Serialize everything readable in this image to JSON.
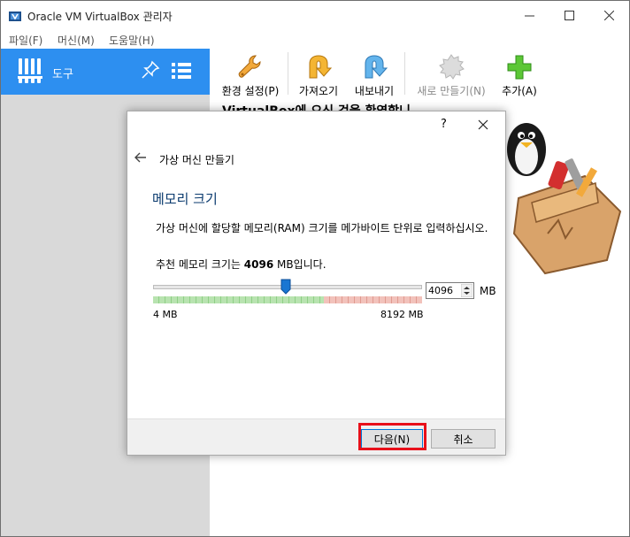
{
  "window": {
    "title": "Oracle VM VirtualBox 관리자"
  },
  "menu": [
    "파일(F)",
    "머신(M)",
    "도움말(H)"
  ],
  "sidebar": {
    "tools_label": "도구"
  },
  "toolbar": {
    "buttons": [
      {
        "label": "환경 설정(P)",
        "icon": "wrench-icon",
        "enabled": true
      },
      {
        "label": "가져오기",
        "icon": "import-icon",
        "enabled": true
      },
      {
        "label": "내보내기",
        "icon": "export-icon",
        "enabled": true
      },
      {
        "label": "새로 만들기(N)",
        "icon": "new-icon",
        "enabled": false
      },
      {
        "label": "추가(A)",
        "icon": "add-icon",
        "enabled": true
      }
    ]
  },
  "welcome_text": "VirtualBox에 오신 것을 환영합니",
  "dialog": {
    "help": "?",
    "wizard_title": "가상 머신 만들기",
    "page_title": "메모리 크기",
    "description": "가상 머신에 할당할 메모리(RAM) 크기를 메가바이트 단위로 입력하십시오.",
    "recommend_prefix": "추천 메모리 크기는 ",
    "recommend_value": "4096",
    "recommend_suffix": " MB입니다.",
    "memory": {
      "value": "4096",
      "unit": "MB",
      "min_label": "4 MB",
      "max_label": "8192 MB",
      "slider_fraction": 0.5
    },
    "next_label": "다음(N)",
    "cancel_label": "취소"
  },
  "colors": {
    "accent": "#2d8ff0",
    "highlight": "#e8101a"
  }
}
